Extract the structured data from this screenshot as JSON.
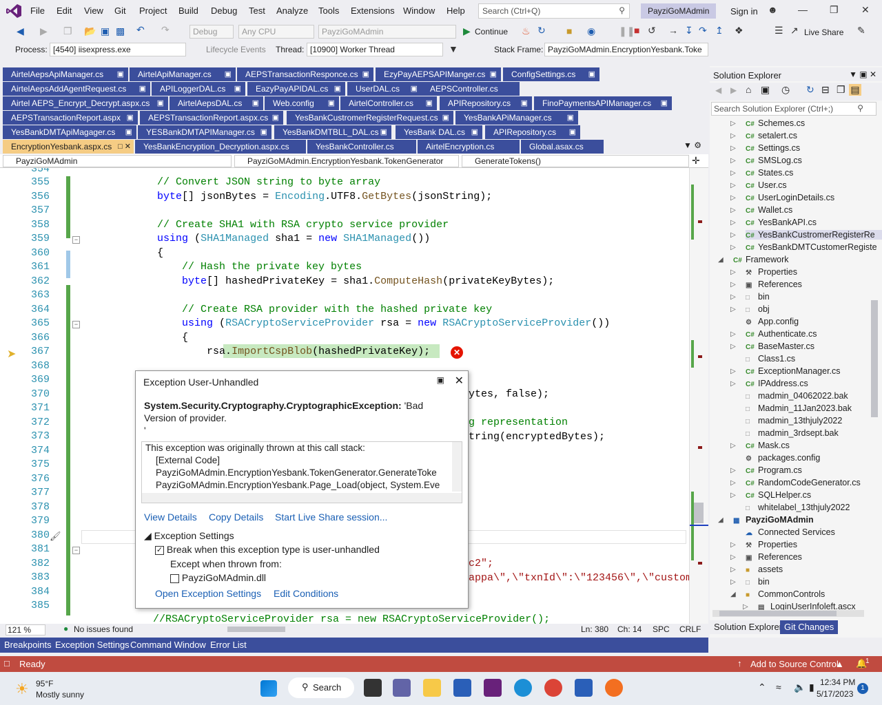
{
  "menu": {
    "items": [
      "File",
      "Edit",
      "View",
      "Git",
      "Project",
      "Build",
      "Debug",
      "Test",
      "Analyze",
      "Tools",
      "Extensions",
      "Window",
      "Help"
    ],
    "search_placeholder": "Search (Ctrl+Q)",
    "solution_name": "PayziGoMAdmin",
    "sign_in": "Sign in"
  },
  "toolbar": {
    "config": "Debug",
    "platform": "Any CPU",
    "startup": "PayziGoMAdmin",
    "continue": "Continue",
    "live_share": "Live Share"
  },
  "debug_location": {
    "process_label": "Process:",
    "process_value": "[4540] iisexpress.exe",
    "lifecycle": "Lifecycle Events",
    "thread_label": "Thread:",
    "thread_value": "[10900] Worker Thread",
    "stack_label": "Stack Frame:",
    "stack_value": "PayziGoMAdmin.EncryptionYesbank.Toke"
  },
  "doc_tabs": [
    [
      "AirtelAepsApiManager.cs",
      "AirtelApiManager.cs",
      "AEPSTransactionResponce.cs",
      "EzyPayAEPSAPIManger.cs",
      "ConfigSettings.cs"
    ],
    [
      "AirtelAepsAddAgentRequest.cs",
      "APILoggerDAL.cs",
      "EazyPayAPIDAL.cs",
      "UserDAL.cs",
      "AEPSController.cs"
    ],
    [
      "Airtel AEPS_Encrypt_Decrypt.aspx.cs",
      "AirtelAepsDAL.cs",
      "Web.config",
      "AirtelController.cs",
      "APIRepository.cs",
      "FinoPaymentsAPIManager.cs"
    ],
    [
      "AEPSTransactionReport.aspx",
      "AEPSTransactionReport.aspx.cs",
      "YesBankCustromerRegisterRequest.cs",
      "YesBankAPiManager.cs"
    ],
    [
      "YesBankDMTApiMagager.cs",
      "YESBankDMTAPIManager.cs",
      "YesBankDMTBLL_DAL.cs",
      "YesBank DAL.cs",
      "APIRepository.cs"
    ],
    [
      "EncryptionYesbank.aspx.cs",
      "YesBankEncryption_Decryption.aspx.cs",
      "YesBankController.cs",
      "AirtelEncryption.cs",
      "Global.asax.cs"
    ]
  ],
  "nav": {
    "project": "PayziGoMAdmin",
    "class": "PayziGoMAdmin.EncryptionYesbank.TokenGenerator",
    "member": "GenerateTokens()"
  },
  "code": {
    "partial_top": "354",
    "lines": [
      {
        "n": "355",
        "t": "            // Convert JSON string to byte array"
      },
      {
        "n": "356",
        "t": "            byte[] jsonBytes = Encoding.UTF8.GetBytes(jsonString);"
      },
      {
        "n": "357",
        "t": ""
      },
      {
        "n": "358",
        "t": "            // Create SHA1 with RSA crypto service provider"
      },
      {
        "n": "359",
        "t": "            using (SHA1Managed sha1 = new SHA1Managed())"
      },
      {
        "n": "360",
        "t": "            {"
      },
      {
        "n": "361",
        "t": "                // Hash the private key bytes"
      },
      {
        "n": "362",
        "t": "                byte[] hashedPrivateKey = sha1.ComputeHash(privateKeyBytes);"
      },
      {
        "n": "363",
        "t": ""
      },
      {
        "n": "364",
        "t": "                // Create RSA provider with the hashed private key"
      },
      {
        "n": "365",
        "t": "                using (RSACryptoServiceProvider rsa = new RSACryptoServiceProvider())"
      },
      {
        "n": "366",
        "t": "                {"
      },
      {
        "n": "367",
        "t": "                    rsa.ImportCspBlob(hashedPrivateKey);"
      },
      {
        "n": "368",
        "t": ""
      },
      {
        "n": "369",
        "t": ""
      },
      {
        "n": "370",
        "t": ""
      },
      {
        "n": "371",
        "t": ""
      },
      {
        "n": "372",
        "t": ""
      },
      {
        "n": "373",
        "t": ""
      },
      {
        "n": "374",
        "t": ""
      },
      {
        "n": "375",
        "t": ""
      },
      {
        "n": "376",
        "t": ""
      },
      {
        "n": "377",
        "t": ""
      },
      {
        "n": "378",
        "t": ""
      },
      {
        "n": "379",
        "t": ""
      },
      {
        "n": "380",
        "t": ""
      },
      {
        "n": "381",
        "t": ""
      },
      {
        "n": "382",
        "t": ""
      },
      {
        "n": "383",
        "t": ""
      },
      {
        "n": "384",
        "t": ""
      },
      {
        "n": "385",
        "t": ""
      }
    ],
    "frag_370": "ytes, false);",
    "frag_372": "g representation",
    "frag_373": "tring(encryptedBytes);",
    "frag_382": "c2\";",
    "frag_383": "appa\\\",\\\"txnId\\\":\\\"123456\\\",\\\"custome",
    "frag_385": "//// Create a new RSA instance",
    "frag_386": "//RSACryptoServiceProvider rsa = new RSACryptoServiceProvider();"
  },
  "exception": {
    "title": "Exception User-Unhandled",
    "type": "System.Security.Cryptography.CryptographicException:",
    "message": "'Bad Version of provider.",
    "message_tail": "'",
    "stack_header": "This exception was originally thrown at this call stack:",
    "stack": [
      "[External Code]",
      "PayziGoMAdmin.EncryptionYesbank.TokenGenerator.GenerateToke",
      "PayziGoMAdmin.EncryptionYesbank.Page_Load(object, System.Eve"
    ],
    "view_details": "View Details",
    "copy_details": "Copy Details",
    "live_share": "Start Live Share session...",
    "settings_header": "Exception Settings",
    "break_when": "Break when this exception type is user-unhandled",
    "break_checked": true,
    "except_when": "Except when thrown from:",
    "dll": "PayziGoMAdmin.dll",
    "dll_checked": false,
    "open_settings": "Open Exception Settings",
    "edit_conditions": "Edit Conditions"
  },
  "editor_status": {
    "zoom": "121 %",
    "issues": "No issues found",
    "ln": "Ln: 380",
    "ch": "Ch: 14",
    "spc": "SPC",
    "crlf": "CRLF"
  },
  "bottom_tabs": [
    "Breakpoints",
    "Exception Settings",
    "Command Window",
    "Error List"
  ],
  "status": {
    "ready": "Ready",
    "source_control": "Add to Source Control",
    "notifications": "1"
  },
  "solution_explorer": {
    "title": "Solution Explorer",
    "search_placeholder": "Search Solution Explorer (Ctrl+;)",
    "items": [
      {
        "label": "Schemes.cs",
        "icon": "C#",
        "arrow": true,
        "indent": 0
      },
      {
        "label": "setalert.cs",
        "icon": "C#",
        "arrow": true,
        "indent": 0
      },
      {
        "label": "Settings.cs",
        "icon": "C#",
        "arrow": true,
        "indent": 0
      },
      {
        "label": "SMSLog.cs",
        "icon": "C#",
        "arrow": true,
        "indent": 0
      },
      {
        "label": "States.cs",
        "icon": "C#",
        "arrow": true,
        "indent": 0
      },
      {
        "label": "User.cs",
        "icon": "C#",
        "arrow": true,
        "indent": 0
      },
      {
        "label": "UserLoginDetails.cs",
        "icon": "C#",
        "arrow": true,
        "indent": 0
      },
      {
        "label": "Wallet.cs",
        "icon": "C#",
        "arrow": true,
        "indent": 0
      },
      {
        "label": "YesBankAPI.cs",
        "icon": "C#",
        "arrow": true,
        "indent": 0
      },
      {
        "label": "YesBankCustromerRegisterRe",
        "icon": "C#",
        "arrow": true,
        "indent": 0
      },
      {
        "label": "YesBankDMTCustomerRegiste",
        "icon": "C#",
        "arrow": true,
        "indent": 0
      },
      {
        "label": "Framework",
        "icon": "C#",
        "arrow": true,
        "indent": -1
      },
      {
        "label": "Properties",
        "icon": "P",
        "arrow": true,
        "indent": 0
      },
      {
        "label": "References",
        "icon": "R",
        "arrow": true,
        "indent": 0
      },
      {
        "label": "bin",
        "icon": "F",
        "arrow": true,
        "indent": 0
      },
      {
        "label": "obj",
        "icon": "F",
        "arrow": true,
        "indent": 0
      },
      {
        "label": "App.config",
        "icon": "X",
        "arrow": false,
        "indent": 0
      },
      {
        "label": "Authenticate.cs",
        "icon": "C#",
        "arrow": true,
        "indent": 0
      },
      {
        "label": "BaseMaster.cs",
        "icon": "C#",
        "arrow": true,
        "indent": 0
      },
      {
        "label": "Class1.cs",
        "icon": "F",
        "arrow": false,
        "indent": 0
      },
      {
        "label": "ExceptionManager.cs",
        "icon": "C#",
        "arrow": true,
        "indent": 0
      },
      {
        "label": "IPAddress.cs",
        "icon": "C#",
        "arrow": true,
        "indent": 0
      },
      {
        "label": "madmin_04062022.bak",
        "icon": "F",
        "arrow": false,
        "indent": 0
      },
      {
        "label": "Madmin_11Jan2023.bak",
        "icon": "F",
        "arrow": false,
        "indent": 0
      },
      {
        "label": "madmin_13thjuly2022",
        "icon": "F",
        "arrow": false,
        "indent": 0
      },
      {
        "label": "madmin_3rdsept.bak",
        "icon": "F",
        "arrow": false,
        "indent": 0
      },
      {
        "label": "Mask.cs",
        "icon": "C#",
        "arrow": true,
        "indent": 0
      },
      {
        "label": "packages.config",
        "icon": "X",
        "arrow": false,
        "indent": 0
      },
      {
        "label": "Program.cs",
        "icon": "C#",
        "arrow": true,
        "indent": 0
      },
      {
        "label": "RandomCodeGenerator.cs",
        "icon": "C#",
        "arrow": true,
        "indent": 0
      },
      {
        "label": "SQLHelper.cs",
        "icon": "C#",
        "arrow": true,
        "indent": 0
      },
      {
        "label": "whitelabel_13thjuly2022",
        "icon": "F",
        "arrow": false,
        "indent": 0
      },
      {
        "label": "PayziGoMAdmin",
        "icon": "W",
        "arrow": true,
        "indent": -1
      },
      {
        "label": "Connected Services",
        "icon": "S",
        "arrow": false,
        "indent": 0
      },
      {
        "label": "Properties",
        "icon": "P",
        "arrow": true,
        "indent": 0
      },
      {
        "label": "References",
        "icon": "R",
        "arrow": true,
        "indent": 0
      },
      {
        "label": "assets",
        "icon": "D",
        "arrow": true,
        "indent": 0
      },
      {
        "label": "bin",
        "icon": "F",
        "arrow": true,
        "indent": 0
      },
      {
        "label": "CommonControls",
        "icon": "D",
        "arrow": true,
        "indent": 0
      },
      {
        "label": "LoginUserInfoleft.ascx",
        "icon": "A",
        "arrow": true,
        "indent": 1
      }
    ],
    "tab_explorer": "Solution Explorer",
    "tab_git": "Git Changes"
  },
  "taskbar": {
    "temp": "95°F",
    "weather": "Mostly sunny",
    "search": "Search",
    "time": "12:34 PM",
    "date": "5/17/2023",
    "badge": "1"
  }
}
